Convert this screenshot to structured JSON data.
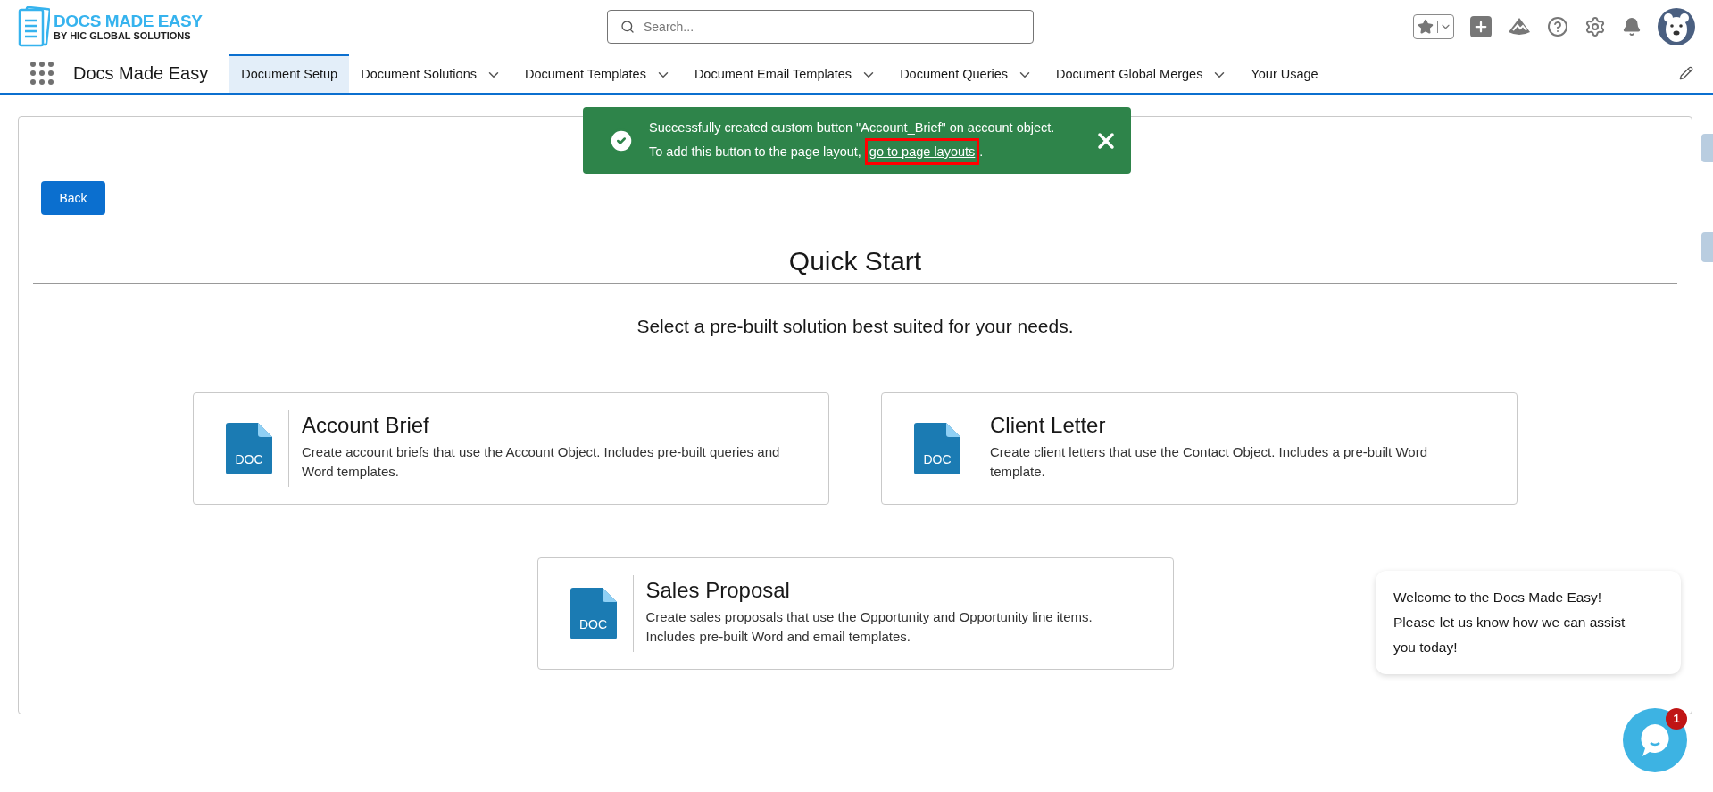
{
  "logo": {
    "title": "DOCS MADE EASY",
    "subtitle": "BY HIC GLOBAL SOLUTIONS"
  },
  "search": {
    "placeholder": "Search..."
  },
  "app_name": "Docs Made Easy",
  "tabs": [
    {
      "label": "Document Setup",
      "selected": true,
      "has_menu": false
    },
    {
      "label": "Document Solutions",
      "selected": false,
      "has_menu": true
    },
    {
      "label": "Document Templates",
      "selected": false,
      "has_menu": true
    },
    {
      "label": "Document Email Templates",
      "selected": false,
      "has_menu": true
    },
    {
      "label": "Document Queries",
      "selected": false,
      "has_menu": true
    },
    {
      "label": "Document Global Merges",
      "selected": false,
      "has_menu": true
    },
    {
      "label": "Your Usage",
      "selected": false,
      "has_menu": false
    }
  ],
  "toast": {
    "line1": "Successfully created custom button \"Account_Brief\" on account object.",
    "line2": "To add this button to the page layout, ",
    "link": "go to page layouts",
    "link_highlighted": true,
    "after_link": "."
  },
  "back_button": "Back",
  "title": "Quick Start",
  "subtitle": "Select a pre-built solution best suited for your needs.",
  "solutions": [
    {
      "icon_label": "DOC",
      "title": "Account Brief",
      "description": "Create account briefs that use the Account Object. Includes pre-built queries and Word templates."
    },
    {
      "icon_label": "DOC",
      "title": "Client Letter",
      "description": "Create client letters that use the Contact Object. Includes a pre-built Word template."
    },
    {
      "icon_label": "DOC",
      "title": "Sales Proposal",
      "description": "Create sales proposals that use the Opportunity and Opportunity line items. Includes pre-built Word and email templates."
    }
  ],
  "chat": {
    "message": "Welcome to the Docs Made Easy! Please let us know how we can assist you today!",
    "badge": "1"
  }
}
